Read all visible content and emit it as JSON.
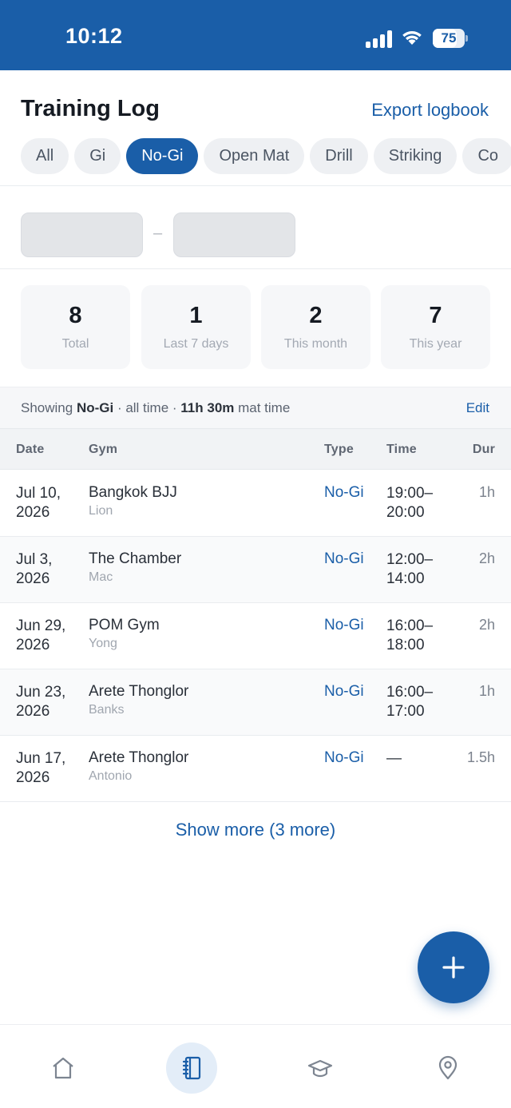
{
  "status_bar": {
    "time": "10:12",
    "battery": "75",
    "battery_level": 0.75
  },
  "header": {
    "title": "Training Log",
    "export_label": "Export logbook"
  },
  "filters": [
    {
      "label": "All",
      "active": false
    },
    {
      "label": "Gi",
      "active": false
    },
    {
      "label": "No-Gi",
      "active": true
    },
    {
      "label": "Open Mat",
      "active": false
    },
    {
      "label": "Drill",
      "active": false
    },
    {
      "label": "Striking",
      "active": false
    },
    {
      "label": "Co",
      "active": false
    }
  ],
  "date_range": {
    "separator": "–"
  },
  "stats": [
    {
      "value": "8",
      "label": "Total"
    },
    {
      "value": "1",
      "label": "Last 7 days"
    },
    {
      "value": "2",
      "label": "This month"
    },
    {
      "value": "7",
      "label": "This year"
    }
  ],
  "summary": {
    "prefix": "Showing ",
    "filter": "No-Gi",
    "middle": " · all time · ",
    "mat_time": "11h 30m",
    "suffix": " mat time",
    "edit_label": "Edit"
  },
  "table": {
    "headers": {
      "date": "Date",
      "gym": "Gym",
      "type": "Type",
      "time": "Time",
      "dur": "Dur"
    },
    "rows": [
      {
        "date": "Jul 10, 2026",
        "gym": "Bangkok BJJ",
        "coach": "Lion",
        "type": "No-Gi",
        "time": "19:00–20:00",
        "dur": "1h"
      },
      {
        "date": "Jul 3, 2026",
        "gym": "The Chamber",
        "coach": "Mac",
        "type": "No-Gi",
        "time": "12:00–14:00",
        "dur": "2h"
      },
      {
        "date": "Jun 29, 2026",
        "gym": "POM Gym",
        "coach": "Yong",
        "type": "No-Gi",
        "time": "16:00–18:00",
        "dur": "2h"
      },
      {
        "date": "Jun 23, 2026",
        "gym": "Arete Thonglor",
        "coach": "Banks",
        "type": "No-Gi",
        "time": "16:00–17:00",
        "dur": "1h"
      },
      {
        "date": "Jun 17, 2026",
        "gym": "Arete Thonglor",
        "coach": "Antonio",
        "type": "No-Gi",
        "time": "—",
        "dur": "1.5h"
      }
    ]
  },
  "show_more_label": "Show more (3 more)",
  "fab_icon": "plus-icon",
  "bottom_nav": [
    {
      "icon": "home-icon",
      "active": false
    },
    {
      "icon": "logbook-icon",
      "active": true
    },
    {
      "icon": "graduation-cap-icon",
      "active": false
    },
    {
      "icon": "map-pin-icon",
      "active": false
    }
  ],
  "colors": {
    "primary": "#1a5ea8",
    "chip_bg": "#eef0f3",
    "text": "#151a22"
  }
}
